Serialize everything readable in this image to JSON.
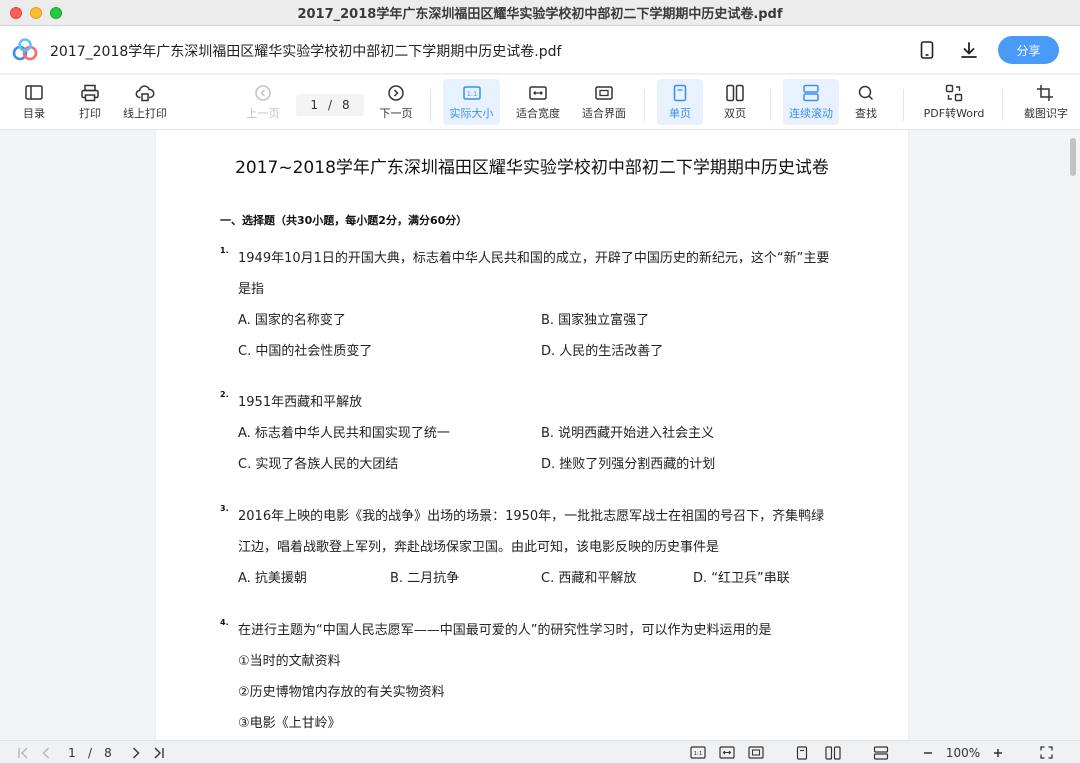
{
  "window": {
    "title": "2017_2018学年广东深圳福田区耀华实验学校初中部初二下学期期中历史试卷.pdf"
  },
  "app": {
    "file_name": "2017_2018学年广东深圳福田区耀华实验学校初中部初二下学期期中历史试卷.pdf",
    "share_label": "分享"
  },
  "toolbar": {
    "catalog": "目录",
    "print": "打印",
    "online_print": "线上打印",
    "prev_page": "上一页",
    "current_page": "1",
    "page_sep": "/",
    "total_pages": "8",
    "next_page": "下一页",
    "actual_size": "实际大小",
    "fit_width": "适合宽度",
    "fit_screen": "适合界面",
    "single_page": "单页",
    "double_page": "双页",
    "continuous_scroll": "连续滚动",
    "find": "查找",
    "pdf_to_word": "PDF转Word",
    "screenshot_ocr": "截图识字"
  },
  "document": {
    "title": "2017~2018学年广东深圳福田区耀华实验学校初中部初二下学期期中历史试卷",
    "section": "一、选择题（共30小题，每小题2分，满分60分）",
    "questions": [
      {
        "num": "1.",
        "stem_line1": "1949年10月1日的开国大典，标志着中华人民共和国的成立，开辟了中国历史的新纪元，这个“新”主要",
        "stem_line2": "是指",
        "a": "A. 国家的名称变了",
        "b": "B. 国家独立富强了",
        "c": "C. 中国的社会性质变了",
        "d": "D. 人民的生活改善了"
      },
      {
        "num": "2.",
        "stem_line1": "1951年西藏和平解放",
        "a": "A. 标志着中华人民共和国实现了统一",
        "b": "B. 说明西藏开始进入社会主义",
        "c": "C. 实现了各族人民的大团结",
        "d": "D. 挫败了列强分割西藏的计划"
      },
      {
        "num": "3.",
        "stem_line1": "2016年上映的电影《我的战争》出场的场景：1950年，一批批志愿军战士在祖国的号召下，齐集鸭绿",
        "stem_line2": "江边，唱着战歌登上军列，奔赴战场保家卫国。由此可知，该电影反映的历史事件是",
        "a": "A. 抗美援朝",
        "b": "B. 二月抗争",
        "c": "C. 西藏和平解放",
        "d": "D. “红卫兵”串联"
      },
      {
        "num": "4.",
        "stem_line1": "在进行主题为“中国人民志愿军——中国最可爱的人”的研究性学习时，可以作为史料运用的是",
        "o1": "①当时的文献资料",
        "o2": "②历史博物馆内存放的有关实物资料",
        "o3": "③电影《上甘岭》"
      }
    ]
  },
  "statusbar": {
    "current_page": "1",
    "sep": "/",
    "total_pages": "8",
    "zoom": "100%"
  },
  "colors": {
    "accent": "#4a9bf7",
    "active_bg": "#e8f2fe"
  }
}
